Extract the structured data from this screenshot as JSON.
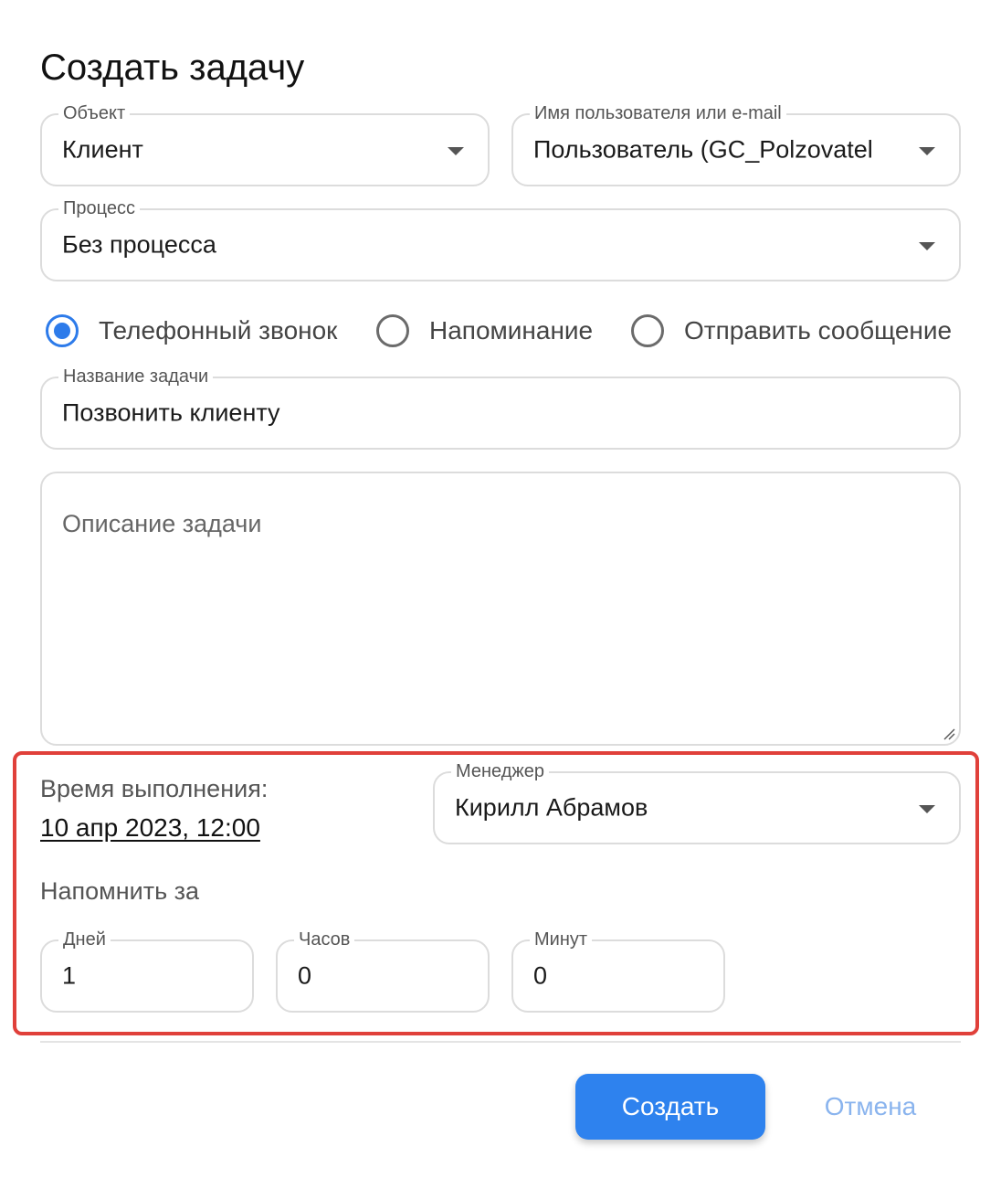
{
  "dialog": {
    "title": "Создать задачу"
  },
  "object_field": {
    "label": "Объект",
    "value": "Клиент"
  },
  "user_field": {
    "label": "Имя пользователя или e-mail",
    "value": "Пользователь (GC_Polzovatel"
  },
  "process_field": {
    "label": "Процесс",
    "value": "Без процесса"
  },
  "task_type": {
    "options": [
      "Телефонный звонок",
      "Напоминание",
      "Отправить сообщение"
    ],
    "selected": "Телефонный звонок"
  },
  "task_name": {
    "label": "Название задачи",
    "value": "Позвонить клиенту"
  },
  "task_description": {
    "placeholder": "Описание задачи",
    "value": ""
  },
  "execution": {
    "label": "Время выполнения:",
    "value": "10 апр 2023, 12:00"
  },
  "manager_field": {
    "label": "Менеджер",
    "value": "Кирилл Абрамов"
  },
  "remind": {
    "label": "Напомнить за",
    "days": {
      "label": "Дней",
      "value": "1"
    },
    "hours": {
      "label": "Часов",
      "value": "0"
    },
    "minutes": {
      "label": "Минут",
      "value": "0"
    }
  },
  "actions": {
    "create_label": "Создать",
    "cancel_label": "Отмена"
  },
  "colors": {
    "accent": "#2e82ee",
    "highlight": "#e0403a",
    "cancel_text": "#8ab4ee"
  }
}
